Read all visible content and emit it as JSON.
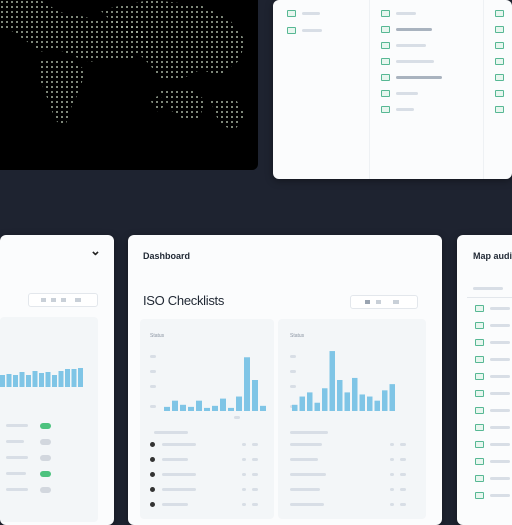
{
  "map_card": {
    "title": ""
  },
  "list_card": {
    "col1_items": [
      "",
      ""
    ],
    "col2_items": [
      "",
      "",
      "",
      "",
      "",
      "",
      ""
    ],
    "col3_items": [
      "",
      "",
      "",
      "",
      "",
      "",
      ""
    ]
  },
  "left_card": {
    "collapse_glyph": "⌄",
    "bars": [
      12,
      13,
      12,
      15,
      12,
      16,
      14,
      15,
      12,
      16,
      18,
      18,
      19
    ]
  },
  "center_card": {
    "header": "Dashboard",
    "title": "ISO Checklists",
    "tabs": [
      "",
      "",
      ""
    ],
    "left_panel": {
      "label": "Status",
      "y_ticks": [
        "",
        "",
        "",
        ""
      ],
      "bars": [
        4,
        10,
        6,
        4,
        10,
        3,
        5,
        12,
        3,
        14,
        52,
        30,
        5
      ],
      "row_header": "",
      "rows": [
        "",
        "",
        "",
        "",
        ""
      ]
    },
    "right_panel": {
      "label": "Status",
      "y_ticks": [
        "",
        "",
        "",
        ""
      ],
      "bars": [
        6,
        14,
        18,
        8,
        22,
        58,
        30,
        18,
        32,
        16,
        14,
        10,
        20,
        26
      ],
      "row_header": "",
      "rows": [
        "",
        "",
        "",
        "",
        ""
      ]
    }
  },
  "right_card": {
    "title": "Map audits",
    "subtitle": "",
    "items": [
      "",
      "",
      "",
      "",
      "",
      "",
      "",
      "",
      "",
      "",
      "",
      ""
    ]
  },
  "colors": {
    "background": "#1e2330",
    "card": "#fbfcfd",
    "accent_bar": "#7fc5e6",
    "check_green": "#57b894",
    "toggle_green": "#4cc27e"
  }
}
